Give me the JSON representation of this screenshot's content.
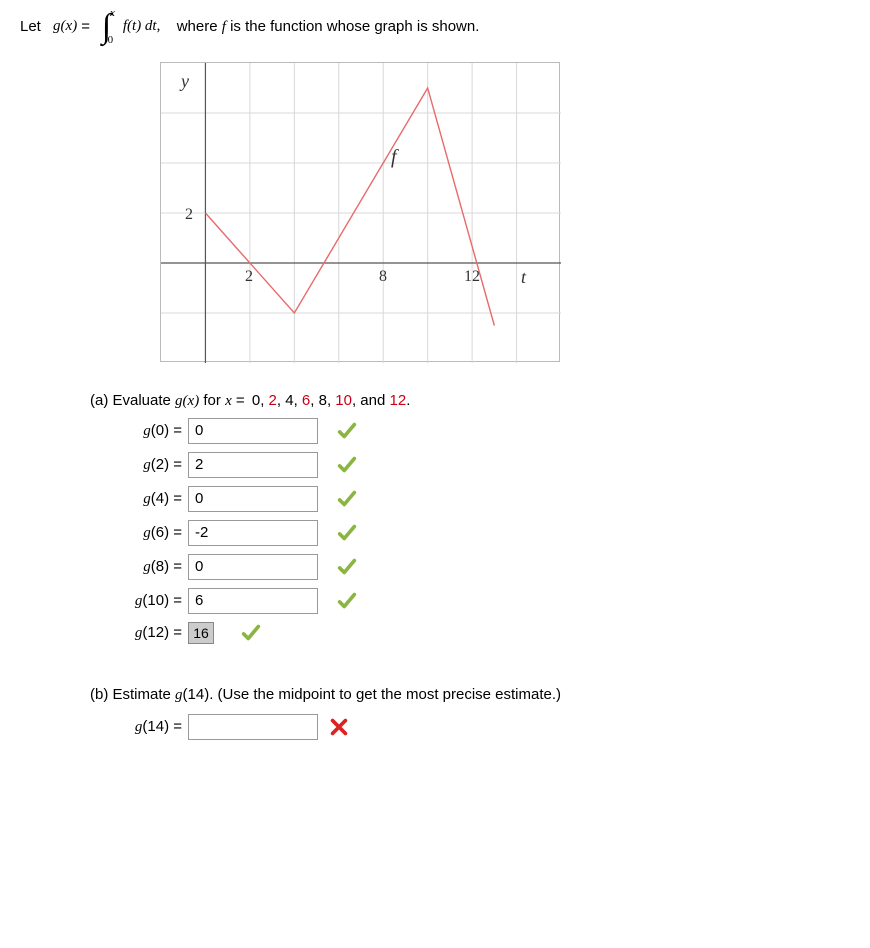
{
  "prompt": {
    "lead": "Let",
    "gx": "g(x)",
    "equals": " = ",
    "upper": "x",
    "lower": "0",
    "integrand": "f(t) dt,",
    "tail": "where f is the function whose graph is shown."
  },
  "graph": {
    "y_label": "y",
    "f_label": "f",
    "tick_y": "2",
    "tick_x1": "2",
    "tick_x2": "8",
    "tick_x3": "12",
    "t_label": "t"
  },
  "partA": {
    "lead": "(a) Evaluate ",
    "gx": "g(x)",
    "for_text": " for ",
    "xeq": "x = ",
    "vals": [
      "0",
      "2",
      "4",
      "6",
      "8",
      "10",
      "12"
    ],
    "and": " and "
  },
  "answers": [
    {
      "label": "g(0) =",
      "value": "0",
      "correct": true
    },
    {
      "label": "g(2) =",
      "value": "2",
      "correct": true
    },
    {
      "label": "g(4) =",
      "value": "0",
      "correct": true
    },
    {
      "label": "g(6) =",
      "value": "-2",
      "correct": true
    },
    {
      "label": "g(8) =",
      "value": "0",
      "correct": true
    },
    {
      "label": "g(10) =",
      "value": "6",
      "correct": true
    }
  ],
  "static_answer": {
    "label": "g(12) =",
    "value": "16",
    "correct": true
  },
  "partB": {
    "text": "(b) Estimate g(14). (Use the midpoint to get the most precise estimate.)",
    "label": "g(14) =",
    "value": "",
    "correct": false
  },
  "chart_data": {
    "type": "line",
    "series": [
      {
        "name": "f",
        "x": [
          0,
          4,
          10,
          13
        ],
        "y": [
          2,
          -2,
          7,
          -2.5
        ]
      }
    ],
    "xlabel": "t",
    "ylabel": "y",
    "x_ticks": [
      2,
      8,
      12
    ],
    "y_ticks": [
      2
    ],
    "xlim": [
      -2,
      16
    ],
    "ylim": [
      -4,
      8
    ],
    "grid": true
  }
}
